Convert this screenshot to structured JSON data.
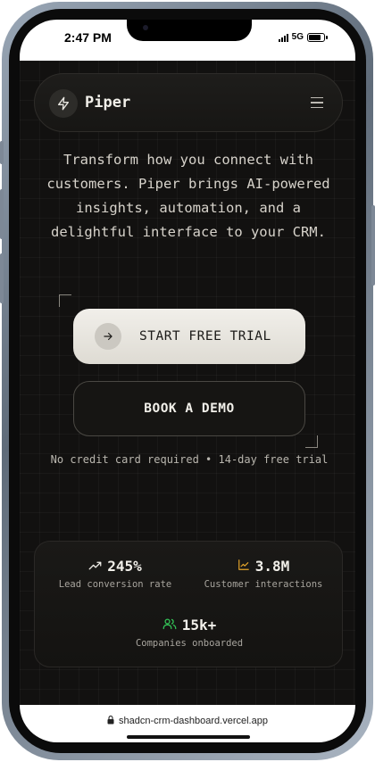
{
  "status_bar": {
    "time": "2:47 PM",
    "network": "5G"
  },
  "navbar": {
    "logo_icon": "bolt-icon",
    "brand": "Piper",
    "menu_icon": "hamburger-menu-icon"
  },
  "hero": {
    "description": "Transform how you connect with customers. Piper brings AI-powered insights, automation, and a delightful interface to your CRM."
  },
  "cta": {
    "primary_label": "START FREE TRIAL",
    "primary_icon": "arrow-right-icon",
    "secondary_label": "BOOK A DEMO",
    "note": "No credit card required • 14-day free trial"
  },
  "stats": [
    {
      "icon": "trending-up-icon",
      "value": "245%",
      "label": "Lead conversion rate",
      "color": "#f2f0ea"
    },
    {
      "icon": "chart-icon",
      "value": "3.8M",
      "label": "Customer interactions",
      "color": "#e5a52b"
    },
    {
      "icon": "users-icon",
      "value": "15k+",
      "label": "Companies onboarded",
      "color": "#34c759"
    }
  ],
  "browser": {
    "url": "shadcn-crm-dashboard.vercel.app"
  },
  "colors": {
    "background": "#121110",
    "primary_button": "#e8e6e0",
    "chart_icon": "#e5a52b",
    "users_icon": "#34c759"
  }
}
